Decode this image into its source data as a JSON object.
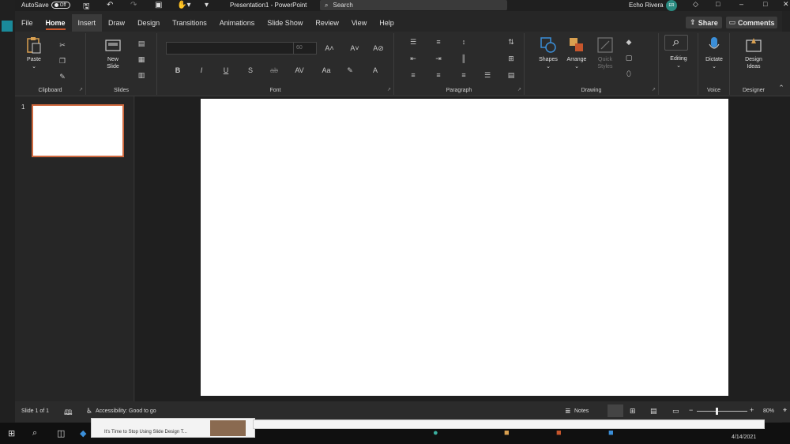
{
  "titlebar": {
    "autosave_label": "AutoSave",
    "autosave_state": "Off",
    "doc_title": "Presentation1 - PowerPoint",
    "search_placeholder": "Search",
    "user_name": "Echo Rivera",
    "user_initials": "ER"
  },
  "tabs": [
    "File",
    "Home",
    "Insert",
    "Draw",
    "Design",
    "Transitions",
    "Animations",
    "Slide Show",
    "Review",
    "View",
    "Help"
  ],
  "active_tab": "Home",
  "actions": {
    "share": "Share",
    "comments": "Comments"
  },
  "ribbon": {
    "clipboard": {
      "label": "Clipboard",
      "paste": "Paste"
    },
    "slides": {
      "label": "Slides",
      "new_slide_1": "New",
      "new_slide_2": "Slide"
    },
    "font": {
      "label": "Font",
      "font_size": "60"
    },
    "paragraph": {
      "label": "Paragraph"
    },
    "drawing": {
      "label": "Drawing",
      "shapes": "Shapes",
      "arrange": "Arrange",
      "quick_styles_1": "Quick",
      "quick_styles_2": "Styles"
    },
    "editing": {
      "label": "Editing"
    },
    "voice": {
      "label": "Voice",
      "dictate": "Dictate"
    },
    "designer": {
      "label": "Designer",
      "design_ideas_1": "Design",
      "design_ideas_2": "Ideas"
    }
  },
  "thumbnails": {
    "slide_number": "1"
  },
  "status": {
    "slide_count": "Slide 1 of 1",
    "accessibility": "Accessibility: Good to go",
    "notes": "Notes",
    "zoom": "80%"
  },
  "taskbar": {
    "popup_title": "It's Time to Stop Using Slide Design T...",
    "date": "4/14/2021"
  },
  "colors": {
    "accent": "#c7562c",
    "thumb_border": "#d0693f",
    "avatar": "#2a8a80"
  }
}
